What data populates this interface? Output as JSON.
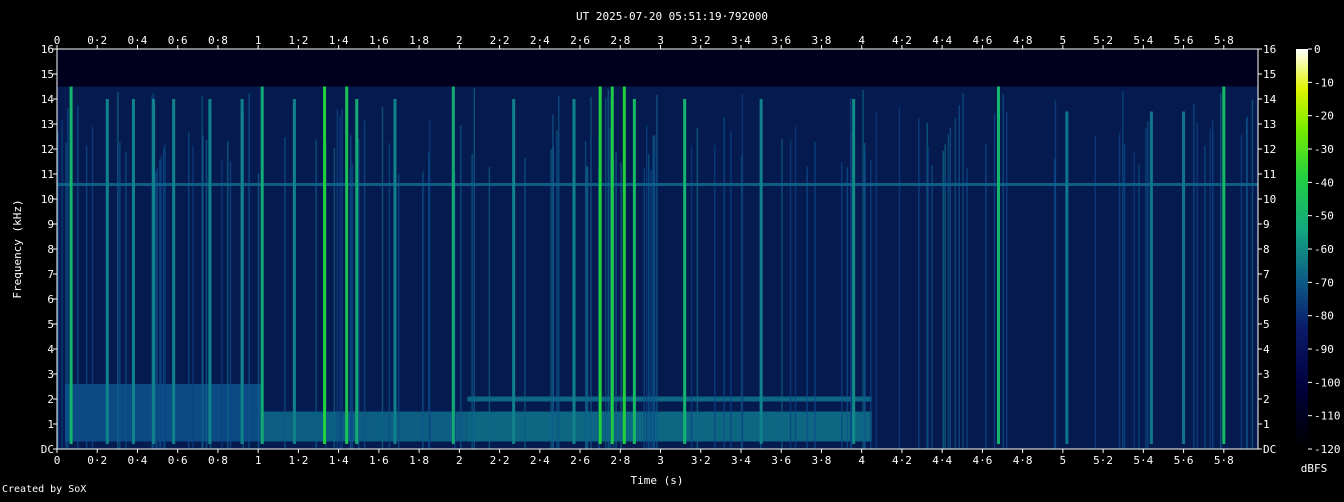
{
  "chart_data": {
    "type": "heatmap",
    "title": "UT 2025-07-20 05:51:19·792000",
    "xlabel": "Time (s)",
    "ylabel": "Frequency (kHz)",
    "xlim": [
      0,
      5.97
    ],
    "ylim": [
      0,
      16
    ],
    "x_tick_labels": [
      "0",
      "0·2",
      "0·4",
      "0·6",
      "0·8",
      "1",
      "1·2",
      "1·4",
      "1·6",
      "1·8",
      "2",
      "2·2",
      "2·4",
      "2·6",
      "2·8",
      "3",
      "3·2",
      "3·4",
      "3·6",
      "3·8",
      "4",
      "4·2",
      "4·4",
      "4·6",
      "4·8",
      "5",
      "5·2",
      "5·4",
      "5·6",
      "5·8"
    ],
    "y_tick_labels": [
      "DC",
      "1",
      "2",
      "3",
      "4",
      "5",
      "6",
      "7",
      "8",
      "9",
      "10",
      "11",
      "12",
      "13",
      "14",
      "15",
      "16"
    ],
    "colorbar": {
      "label": "dBFS",
      "ticks": [
        "0",
        "-10",
        "-20",
        "-30",
        "-40",
        "-50",
        "-60",
        "-70",
        "-80",
        "-90",
        "-100",
        "-110",
        "-120"
      ],
      "range": [
        -120,
        0
      ]
    },
    "background_level_dbfs": -110,
    "noise_floor_dbfs": -95,
    "persistent_tone": {
      "freq_khz": 10.6,
      "level_dbfs": -85
    },
    "transients": [
      {
        "t": 0.07,
        "top_khz": 14.5,
        "level_dbfs": -70
      },
      {
        "t": 0.25,
        "top_khz": 14,
        "level_dbfs": -80
      },
      {
        "t": 0.38,
        "top_khz": 14,
        "level_dbfs": -80
      },
      {
        "t": 0.48,
        "top_khz": 14,
        "level_dbfs": -80
      },
      {
        "t": 0.58,
        "top_khz": 14,
        "level_dbfs": -80
      },
      {
        "t": 0.76,
        "top_khz": 14,
        "level_dbfs": -80
      },
      {
        "t": 0.92,
        "top_khz": 14,
        "level_dbfs": -80
      },
      {
        "t": 1.02,
        "top_khz": 14.5,
        "level_dbfs": -72
      },
      {
        "t": 1.18,
        "top_khz": 14,
        "level_dbfs": -80
      },
      {
        "t": 1.33,
        "top_khz": 14.5,
        "level_dbfs": -60
      },
      {
        "t": 1.44,
        "top_khz": 14.5,
        "level_dbfs": -65
      },
      {
        "t": 1.49,
        "top_khz": 14,
        "level_dbfs": -72
      },
      {
        "t": 1.68,
        "top_khz": 14,
        "level_dbfs": -80
      },
      {
        "t": 1.97,
        "top_khz": 14.5,
        "level_dbfs": -72
      },
      {
        "t": 2.27,
        "top_khz": 14,
        "level_dbfs": -80
      },
      {
        "t": 2.57,
        "top_khz": 14,
        "level_dbfs": -80
      },
      {
        "t": 2.7,
        "top_khz": 14.5,
        "level_dbfs": -60
      },
      {
        "t": 2.76,
        "top_khz": 14.5,
        "level_dbfs": -62
      },
      {
        "t": 2.82,
        "top_khz": 14.5,
        "level_dbfs": -60
      },
      {
        "t": 2.87,
        "top_khz": 14,
        "level_dbfs": -68
      },
      {
        "t": 3.12,
        "top_khz": 14,
        "level_dbfs": -70
      },
      {
        "t": 3.5,
        "top_khz": 14,
        "level_dbfs": -80
      },
      {
        "t": 3.96,
        "top_khz": 14,
        "level_dbfs": -78
      },
      {
        "t": 4.68,
        "top_khz": 14.5,
        "level_dbfs": -70
      },
      {
        "t": 5.02,
        "top_khz": 13.5,
        "level_dbfs": -82
      },
      {
        "t": 5.44,
        "top_khz": 13.5,
        "level_dbfs": -82
      },
      {
        "t": 5.6,
        "top_khz": 13.5,
        "level_dbfs": -82
      },
      {
        "t": 5.8,
        "top_khz": 14.5,
        "level_dbfs": -68
      }
    ],
    "low_bands": [
      {
        "t0": 0.04,
        "t1": 1.02,
        "f0_khz": 0.3,
        "f1_khz": 2.6,
        "level_dbfs": -88
      },
      {
        "t0": 1.02,
        "t1": 2.04,
        "f0_khz": 0.3,
        "f1_khz": 1.5,
        "level_dbfs": -84
      },
      {
        "t0": 2.04,
        "t1": 4.05,
        "f0_khz": 0.3,
        "f1_khz": 1.5,
        "level_dbfs": -82
      },
      {
        "t0": 2.04,
        "t1": 4.05,
        "f0_khz": 1.9,
        "f1_khz": 2.1,
        "level_dbfs": -82
      }
    ],
    "footer": "Created by SoX"
  }
}
